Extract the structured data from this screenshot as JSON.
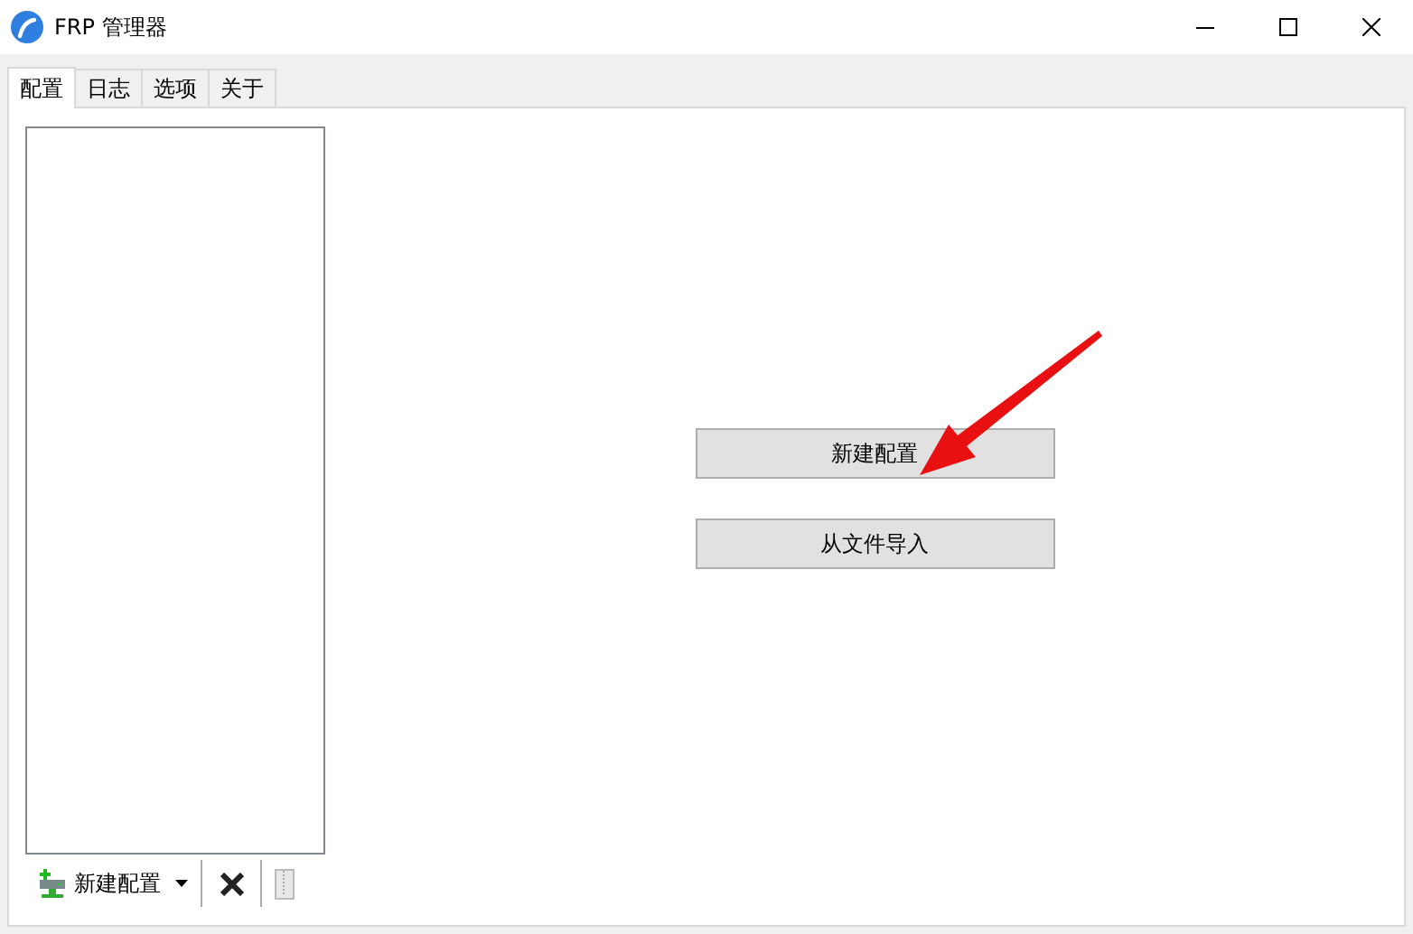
{
  "window": {
    "title": "FRP 管理器"
  },
  "tabs": [
    {
      "label": "配置",
      "selected": true
    },
    {
      "label": "日志",
      "selected": false
    },
    {
      "label": "选项",
      "selected": false
    },
    {
      "label": "关于",
      "selected": false
    }
  ],
  "toolbar": {
    "new_label": "新建配置"
  },
  "actions": [
    "新建配置",
    "从文件导入"
  ]
}
